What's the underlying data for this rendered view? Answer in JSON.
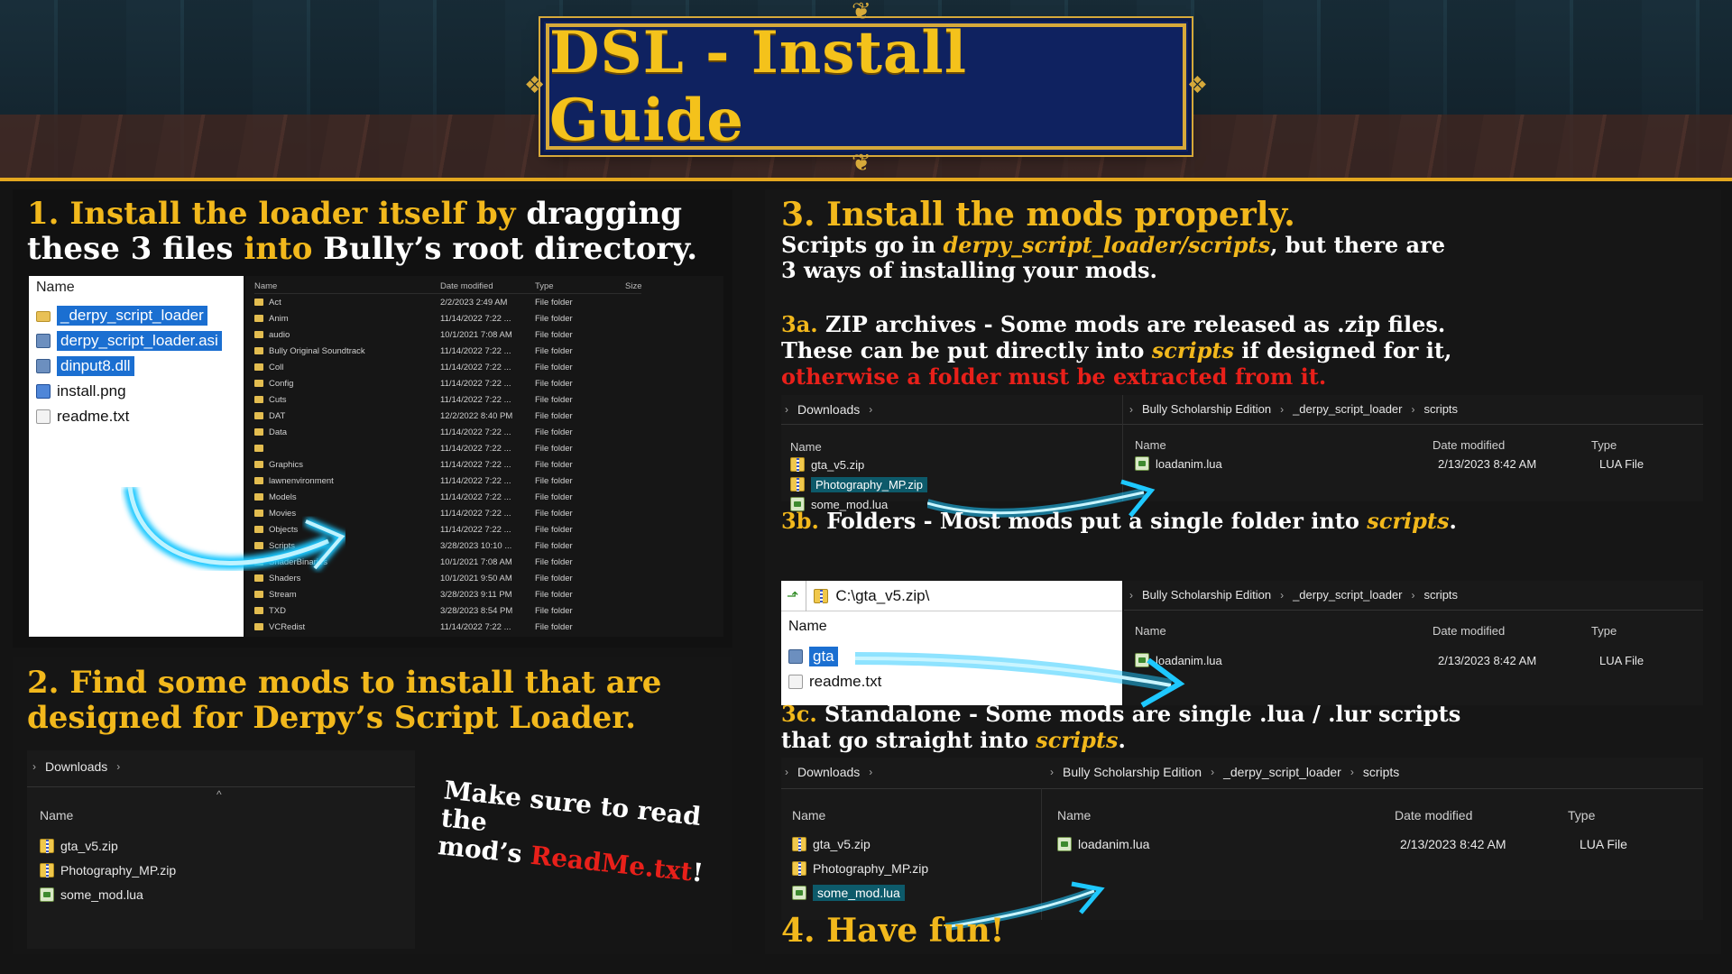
{
  "title": "DSL - Install Guide",
  "step1": {
    "heading_line1_gold": "1. Install the loader itself by",
    "heading_line1_white": " dragging",
    "heading_line2_white_a": "these 3 files ",
    "heading_line2_gold": "into",
    "heading_line2_white_b": " Bully’s root directory.",
    "left_pane": {
      "column": "Name",
      "files": [
        {
          "name": "_derpy_script_loader",
          "icon": "folder-icon",
          "selected": true
        },
        {
          "name": "derpy_script_loader.asi",
          "icon": "asi-file-icon",
          "selected": true
        },
        {
          "name": "dinput8.dll",
          "icon": "dll-file-icon",
          "selected": true
        },
        {
          "name": "install.png",
          "icon": "image-file-icon",
          "selected": false
        },
        {
          "name": "readme.txt",
          "icon": "text-file-icon",
          "selected": false
        }
      ]
    },
    "right_pane": {
      "columns": [
        "Name",
        "Date modified",
        "Type",
        "Size"
      ],
      "rows": [
        [
          "Act",
          "2/2/2023 2:49 AM",
          "File folder"
        ],
        [
          "Anim",
          "11/14/2022 7:22 ...",
          "File folder"
        ],
        [
          "audio",
          "10/1/2021 7:08 AM",
          "File folder"
        ],
        [
          "Bully Original Soundtrack",
          "11/14/2022 7:22 ...",
          "File folder"
        ],
        [
          "Coll",
          "11/14/2022 7:22 ...",
          "File folder"
        ],
        [
          "Config",
          "11/14/2022 7:22 ...",
          "File folder"
        ],
        [
          "Cuts",
          "11/14/2022 7:22 ...",
          "File folder"
        ],
        [
          "DAT",
          "12/2/2022 8:40 PM",
          "File folder"
        ],
        [
          "Data",
          "11/14/2022 7:22 ...",
          "File folder"
        ],
        [
          "",
          "11/14/2022 7:22 ...",
          "File folder"
        ],
        [
          "Graphics",
          "11/14/2022 7:22 ...",
          "File folder"
        ],
        [
          "lawnenvironment",
          "11/14/2022 7:22 ...",
          "File folder"
        ],
        [
          "Models",
          "11/14/2022 7:22 ...",
          "File folder"
        ],
        [
          "Movies",
          "11/14/2022 7:22 ...",
          "File folder"
        ],
        [
          "Objects",
          "11/14/2022 7:22 ...",
          "File folder"
        ],
        [
          "Scripts",
          "3/28/2023 10:10 ...",
          "File folder"
        ],
        [
          "ShaderBinaries",
          "10/1/2021 7:08 AM",
          "File folder"
        ],
        [
          "Shaders",
          "10/1/2021 9:50 AM",
          "File folder"
        ],
        [
          "Stream",
          "3/28/2023 9:11 PM",
          "File folder"
        ],
        [
          "TXD",
          "3/28/2023 8:54 PM",
          "File folder"
        ],
        [
          "VCRedist",
          "11/14/2022 7:22 ...",
          "File folder"
        ]
      ]
    }
  },
  "step2": {
    "heading_line1": "2. Find some mods to install that are",
    "heading_line2": "designed for Derpy’s Script Loader.",
    "breadcrumb": [
      "Downloads"
    ],
    "column": "Name",
    "files": [
      {
        "name": "gta_v5.zip",
        "icon": "zip-file-icon"
      },
      {
        "name": "Photography_MP.zip",
        "icon": "zip-file-icon"
      },
      {
        "name": "some_mod.lua",
        "icon": "lua-file-icon"
      }
    ],
    "note_line1": "Make sure to read the",
    "note_line2_a": "mod’s ",
    "note_line2_red": "ReadMe.txt",
    "note_line2_b": "!"
  },
  "step3": {
    "heading": "3. Install the mods properly.",
    "sub_line1_a": "Scripts go in ",
    "sub_line1_path": "derpy_script_loader/scripts",
    "sub_line1_b": ", but there are",
    "sub_line2": "3 ways of installing your mods.",
    "a": {
      "label": "3a.",
      "line1": " ZIP archives - Some mods are released as .zip files.",
      "line2_a": "These can be put directly into ",
      "line2_path": "scripts",
      "line2_b": " if designed for it,",
      "line3_red": "otherwise a folder must be extracted from it.",
      "left_breadcrumb": [
        "Downloads"
      ],
      "left_column": "Name",
      "left_files": [
        {
          "name": "gta_v5.zip",
          "icon": "zip-file-icon",
          "selected": false
        },
        {
          "name": "Photography_MP.zip",
          "icon": "zip-file-icon",
          "selected": true
        },
        {
          "name": "some_mod.lua",
          "icon": "lua-file-icon",
          "selected": false
        }
      ],
      "right_breadcrumb": [
        "Bully Scholarship Edition",
        "_derpy_script_loader",
        "scripts"
      ],
      "right_columns": [
        "Name",
        "Date modified",
        "Type"
      ],
      "right_row": {
        "name": "loadanim.lua",
        "date": "2/13/2023 8:42 AM",
        "type": "LUA File"
      }
    },
    "b": {
      "label": "3b.",
      "line1_a": " Folders - Most mods put a single folder into ",
      "line1_path": "scripts",
      "line1_b": ".",
      "address": "C:\\gta_v5.zip\\",
      "left_column": "Name",
      "left_files": [
        {
          "name": "gta",
          "icon": "folder-icon",
          "selected": true
        },
        {
          "name": "readme.txt",
          "icon": "text-file-icon",
          "selected": false
        }
      ],
      "right_breadcrumb": [
        "Bully Scholarship Edition",
        "_derpy_script_loader",
        "scripts"
      ],
      "right_columns": [
        "Name",
        "Date modified",
        "Type"
      ],
      "right_row": {
        "name": "loadanim.lua",
        "date": "2/13/2023 8:42 AM",
        "type": "LUA File"
      }
    },
    "c": {
      "label": "3c.",
      "line1": " Standalone - Some mods are single .lua / .lur scripts",
      "line2_a": "that go straight into ",
      "line2_path": "scripts",
      "line2_b": ".",
      "left_breadcrumb": [
        "Downloads"
      ],
      "left_column": "Name",
      "left_files": [
        {
          "name": "gta_v5.zip",
          "icon": "zip-file-icon",
          "selected": false
        },
        {
          "name": "Photography_MP.zip",
          "icon": "zip-file-icon",
          "selected": false
        },
        {
          "name": "some_mod.lua",
          "icon": "lua-file-icon",
          "selected": true
        }
      ],
      "right_breadcrumb": [
        "Bully Scholarship Edition",
        "_derpy_script_loader",
        "scripts"
      ],
      "right_columns": [
        "Name",
        "Date modified",
        "Type"
      ],
      "right_row": {
        "name": "loadanim.lua",
        "date": "2/13/2023 8:42 AM",
        "type": "LUA File"
      }
    }
  },
  "step4": {
    "heading": "4. Have fun!"
  },
  "colors": {
    "gold": "#f2b81c",
    "red": "#e8201a",
    "selection": "#1b6fd1",
    "frame_blue": "#0f2260",
    "arrow": "#1ec8ff"
  }
}
